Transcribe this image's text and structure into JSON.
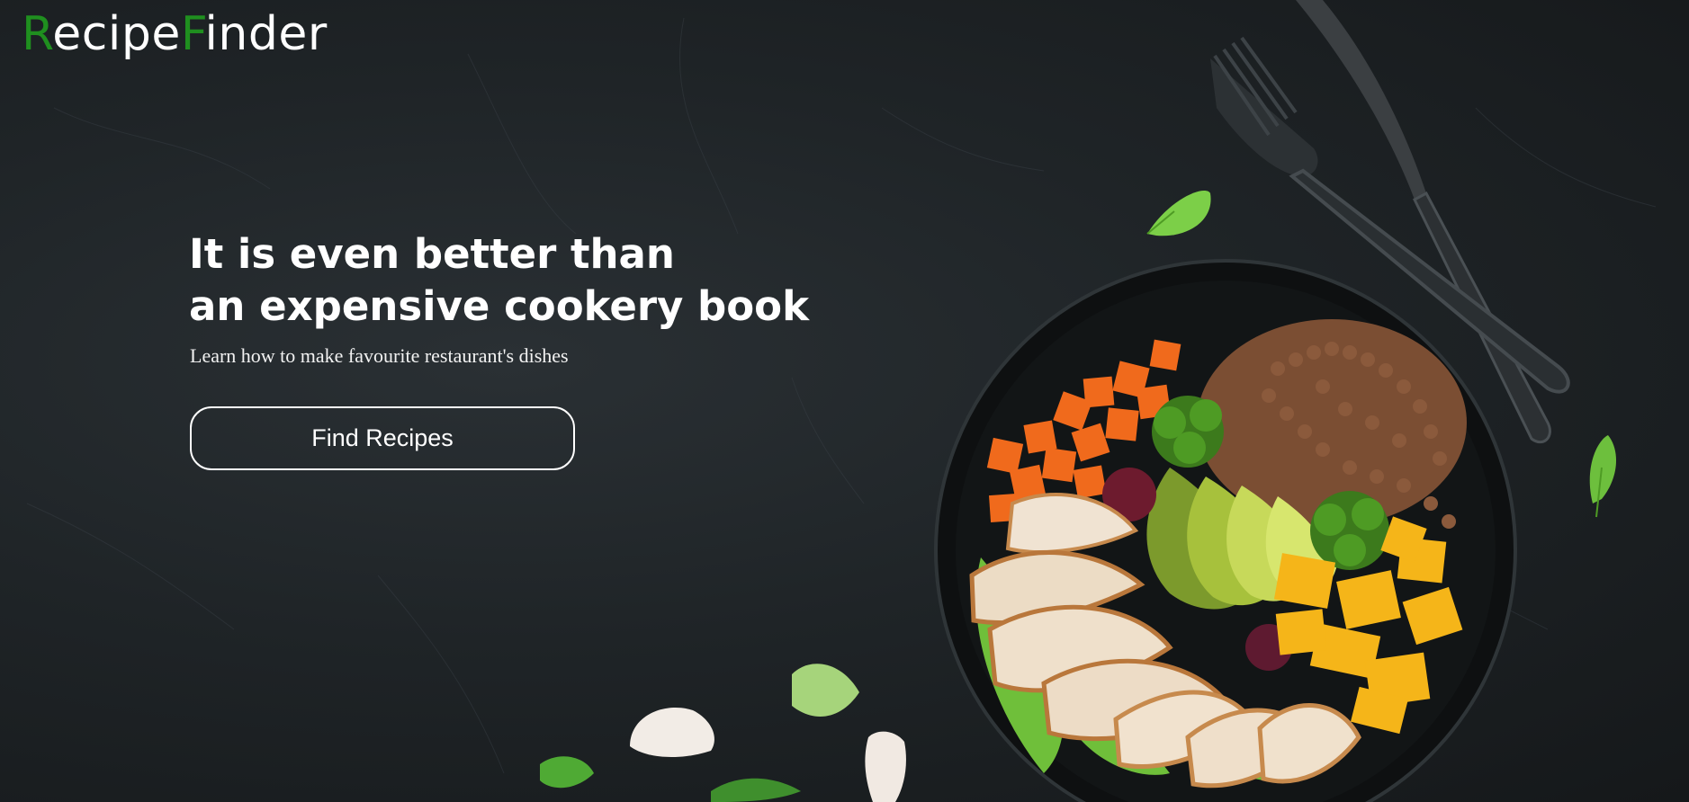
{
  "brand": {
    "first_initial": "R",
    "first_rest": "ecipe",
    "second_initial": "F",
    "second_rest": "inder",
    "accent_color": "#1f8f1f"
  },
  "hero": {
    "headline_line1": "It is even better than",
    "headline_line2": "an expensive cookery book",
    "subtitle": "Learn how to make favourite restaurant's dishes",
    "cta_label": "Find Recipes"
  },
  "background": {
    "base_color": "#1b1f22",
    "illustration": [
      "bowl-image",
      "fork-icon",
      "knife-icon",
      "basil-leaf-icon",
      "garlic-icon"
    ]
  }
}
